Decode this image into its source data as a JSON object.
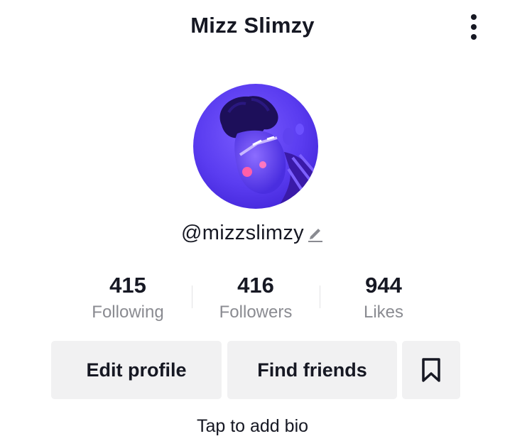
{
  "header": {
    "title": "Mizz Slimzy"
  },
  "profile": {
    "handle": "@mizzslimzy",
    "bio_prompt": "Tap to add bio"
  },
  "stats": [
    {
      "value": "415",
      "label": "Following"
    },
    {
      "value": "416",
      "label": "Followers"
    },
    {
      "value": "944",
      "label": "Likes"
    }
  ],
  "actions": {
    "edit_profile": "Edit profile",
    "find_friends": "Find friends"
  },
  "icons": {
    "more": "more-vertical-icon",
    "edit": "pencil-icon",
    "bookmark": "bookmark-icon"
  },
  "colors": {
    "text_primary": "#161823",
    "text_secondary": "#8a8b91",
    "button_bg": "#f1f1f2",
    "avatar_tint": "#5a3cf0"
  }
}
